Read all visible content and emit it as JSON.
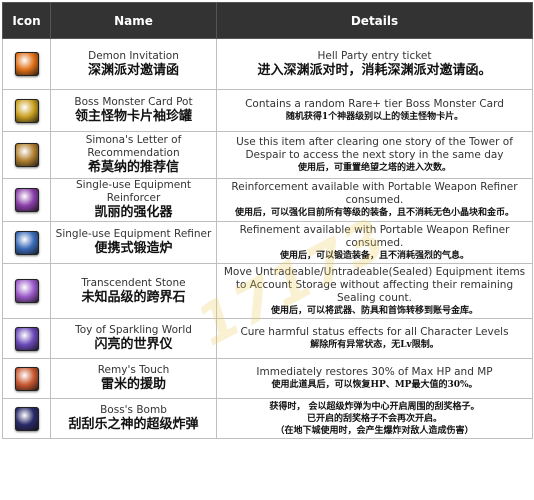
{
  "header": {
    "icon": "Icon",
    "name": "Name",
    "details": "Details"
  },
  "watermark": "17173",
  "rows": [
    {
      "icon": "demon-invitation-icon",
      "color": "#e07018",
      "name_en": "Demon Invitation",
      "name_cn": "深渊派对邀请函",
      "details_en": "Hell Party entry ticket",
      "details_cn": "进入深渊派对时，消耗深渊派对邀请函。"
    },
    {
      "icon": "card-pot-icon",
      "color": "#c9a020",
      "name_en": "Boss Monster Card Pot",
      "name_cn": "领主怪物卡片袖珍罐",
      "details_en": "Contains a random Rare+ tier Boss Monster Card",
      "details_cn": "随机获得1个神器级别以上的领主怪物卡片。"
    },
    {
      "icon": "letter-of-recommendation-icon",
      "color": "#b08030",
      "name_en": "Simona's Letter of Recommendation",
      "name_cn": "希莫纳的推荐信",
      "details_en": "Use this item after clearing one story of the Tower of Despair to access the next story in the same day",
      "details_cn": "使用后，可重置绝望之塔的进入次数。"
    },
    {
      "icon": "equipment-reinforcer-icon",
      "color": "#8a3fa8",
      "name_en": "Single-use Equipment Reinforcer",
      "name_cn": "凯丽的强化器",
      "details_en": "Reinforcement available with Portable Weapon Refiner consumed.",
      "details_cn": "使用后，可以强化目前所有等级的装备，且不消耗无色小晶块和金币。"
    },
    {
      "icon": "equipment-refiner-icon",
      "color": "#3a6ab8",
      "name_en": "Single-use Equipment Refiner",
      "name_cn": "便携式锻造炉",
      "details_en": "Refinement available with Portable Weapon Refiner consumed.",
      "details_cn": "使用后，可以锻造装备，且不消耗强烈的气息。"
    },
    {
      "icon": "transcendent-stone-icon",
      "color": "#9b59c8",
      "name_en": "Transcendent Stone",
      "name_cn": "未知品级的跨界石",
      "details_en": "Move Untradeable/Untradeable(Sealed) Equipment items to Account Storage without affecting their remaining Sealing count.",
      "details_cn": "使用后，可以将武器、防具和首饰转移到账号金库。"
    },
    {
      "icon": "sparkling-world-toy-icon",
      "color": "#6a48b8",
      "name_en": "Toy of Sparkling World",
      "name_cn": "闪亮的世界仪",
      "details_en": "Cure harmful status effects for all Character Levels",
      "details_cn": "解除所有异常状态，无Lv限制。"
    },
    {
      "icon": "remys-touch-icon",
      "color": "#c85830",
      "name_en": "Remy's Touch",
      "name_cn": "雷米的援助",
      "details_en": "Immediately restores 30% of Max HP and MP",
      "details_cn": "使用此道具后，可以恢复HP、MP最大值的30%。"
    },
    {
      "icon": "boss-bomb-icon",
      "color": "#2a2a6a",
      "name_en": "Boss's Bomb",
      "name_cn": "刮刮乐之神的超级炸弹",
      "details_en": "",
      "details_cn_lines": [
        "获得时，  会以超级炸弹为中心开启周围的刮奖格子。",
        "已开启的刮奖格子不会再次开启。",
        "（在地下城使用时，会产生爆炸对敌人造成伤害）"
      ]
    }
  ]
}
